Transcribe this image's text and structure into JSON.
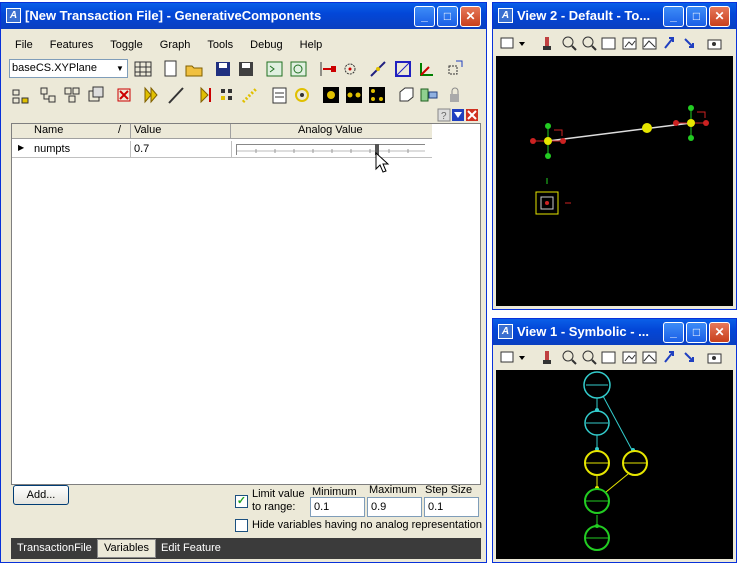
{
  "main_window": {
    "title": "[New Transaction File] - GenerativeComponents",
    "menu": [
      "File",
      "Features",
      "Toggle",
      "Graph",
      "Tools",
      "Debug",
      "Help"
    ],
    "plane_select": "baseCS.XYPlane",
    "grid": {
      "columns": [
        "Name",
        "/",
        "Value",
        "Analog Value"
      ],
      "rows": [
        {
          "name": "numpts",
          "value": "0.7",
          "analog_fraction": 0.75
        }
      ]
    },
    "add_button": "Add...",
    "limit_label": "Limit value",
    "limit_label2": "to range:",
    "min_label": "Minimum",
    "max_label": "Maximum",
    "step_label": "Step Size",
    "min_value": "0.1",
    "max_value": "0.9",
    "step_value": "0.1",
    "limit_checked": true,
    "hide_label": "Hide variables having no analog representation",
    "tabs": [
      "TransactionFile",
      "Variables",
      "Edit Feature"
    ],
    "active_tab": "Variables"
  },
  "view2": {
    "title": "View 2 - Default - To..."
  },
  "view1": {
    "title": "View 1 - Symbolic - ..."
  },
  "colors": {
    "title_blue": "#0a4fdc",
    "viewport": "#000000",
    "node_cyan": "#33cccc",
    "node_yellow": "#e6e600",
    "node_green": "#22cc22"
  }
}
